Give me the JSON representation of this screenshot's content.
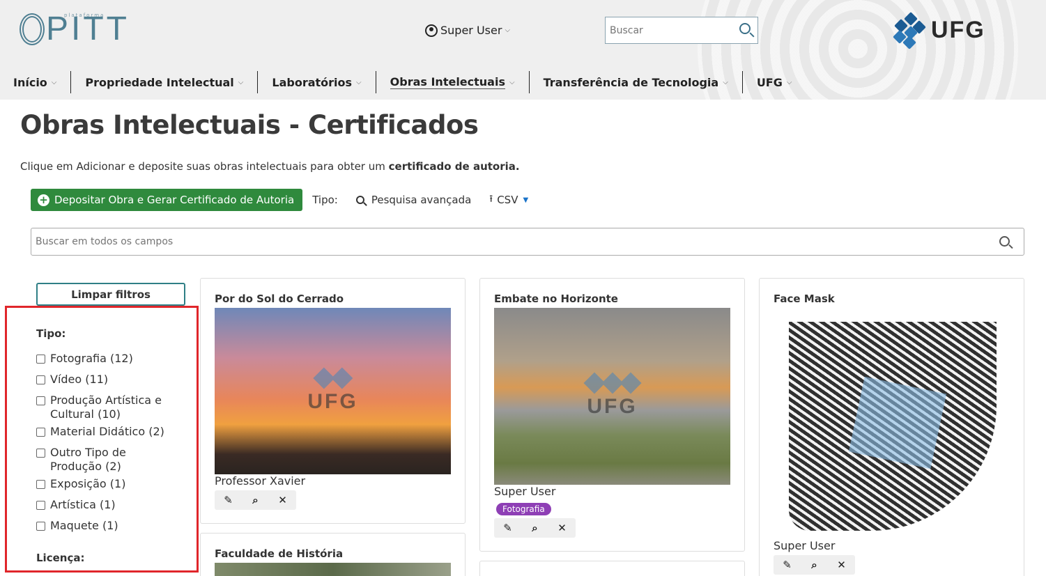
{
  "header": {
    "logo_text": "PITT",
    "logo_small": "plataforma",
    "user_name": "Super User",
    "search_placeholder": "Buscar",
    "institution_logo": "UFG"
  },
  "nav": [
    {
      "label": "Início"
    },
    {
      "label": "Propriedade Intelectual"
    },
    {
      "label": "Laboratórios"
    },
    {
      "label": "Obras Intelectuais"
    },
    {
      "label": "Transferência de Tecnologia"
    },
    {
      "label": "UFG"
    }
  ],
  "page": {
    "title": "Obras Intelectuais - Certificados",
    "intro_text": "Clique em Adicionar e deposite suas obras intelectuais para obter um ",
    "intro_bold": "certificado de autoria."
  },
  "toolbar": {
    "deposit_label": "Depositar Obra e Gerar Certificado de Autoria",
    "tipo_label": "Tipo:",
    "advanced_label": "Pesquisa avançada",
    "csv_label": "CSV"
  },
  "search_all": {
    "placeholder": "Buscar em todos os campos"
  },
  "sidebar": {
    "clear_label": "Limpar filtros",
    "tipo_title": "Tipo:",
    "options": [
      {
        "label": "Fotografia (12)"
      },
      {
        "label": "Vídeo (11)"
      },
      {
        "label": "Produção Artística e Cultural (10)"
      },
      {
        "label": "Material Didático (2)"
      },
      {
        "label": "Outro Tipo de Produção (2)"
      },
      {
        "label": "Exposição (1)"
      },
      {
        "label": "Artística (1)"
      },
      {
        "label": "Maquete (1)"
      }
    ],
    "license_title": "Licença:"
  },
  "cards": [
    {
      "title": "Por do Sol do Cerrado",
      "author": "Professor Xavier",
      "badge": ""
    },
    {
      "title": "Embate no Horizonte",
      "author": "Super User",
      "badge": "Fotografia"
    },
    {
      "title": "Face Mask",
      "author": "Super User",
      "badge": ""
    },
    {
      "title": "Faculdade de História",
      "author": "",
      "badge": ""
    }
  ],
  "watermark": "UFG",
  "actions": {
    "edit": "edit-icon",
    "view": "search-icon",
    "delete": "close-icon"
  },
  "colors": {
    "primary_green": "#2f8a3d",
    "badge_purple": "#8e3fb5",
    "highlight_red": "#e0262b",
    "brand_blue": "#1b5b93"
  }
}
